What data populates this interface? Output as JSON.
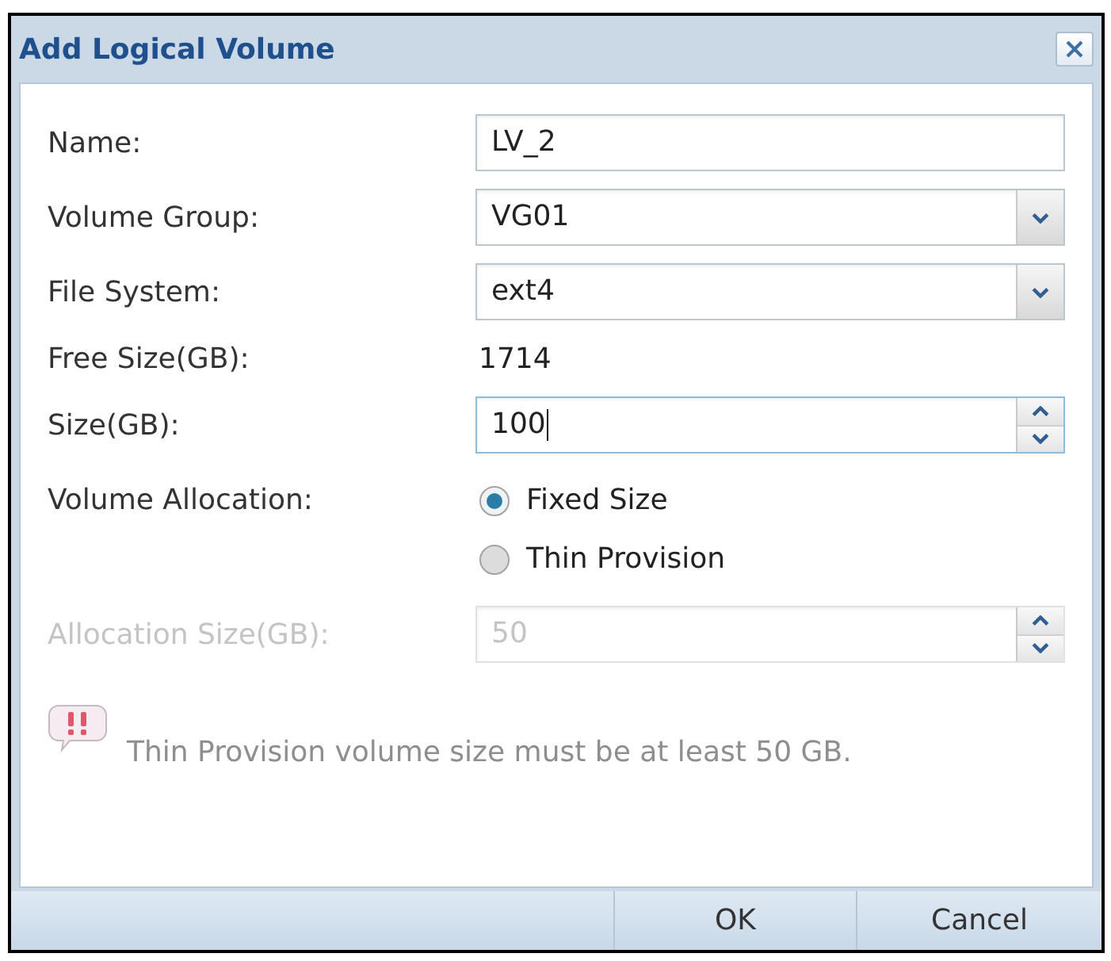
{
  "window": {
    "title": "Add Logical Volume"
  },
  "fields": [
    {
      "kind": "text",
      "label": "Name:",
      "value": "LV_2",
      "focused": false,
      "disabled": false
    },
    {
      "kind": "select",
      "label": "Volume Group:",
      "value": "VG01",
      "focused": false,
      "disabled": false
    },
    {
      "kind": "select",
      "label": "File System:",
      "value": "ext4",
      "focused": false,
      "disabled": false
    },
    {
      "kind": "readout",
      "label": "Free Size(GB):",
      "value": "1714",
      "disabled": false
    },
    {
      "kind": "spinner",
      "label": "Size(GB):",
      "value": "100",
      "focused": true,
      "disabled": false
    },
    {
      "kind": "radio",
      "label": "Volume Allocation:",
      "disabled": false,
      "options": [
        {
          "label": "Fixed Size",
          "selected": true
        },
        {
          "label": "Thin Provision",
          "selected": false
        }
      ]
    },
    {
      "kind": "spinner",
      "label": "Allocation Size(GB):",
      "value": "50",
      "focused": false,
      "disabled": true
    }
  ],
  "notice": {
    "text": "Thin Provision volume size must be at least 50 GB."
  },
  "buttons": [
    {
      "label": "OK"
    },
    {
      "label": "Cancel"
    }
  ]
}
